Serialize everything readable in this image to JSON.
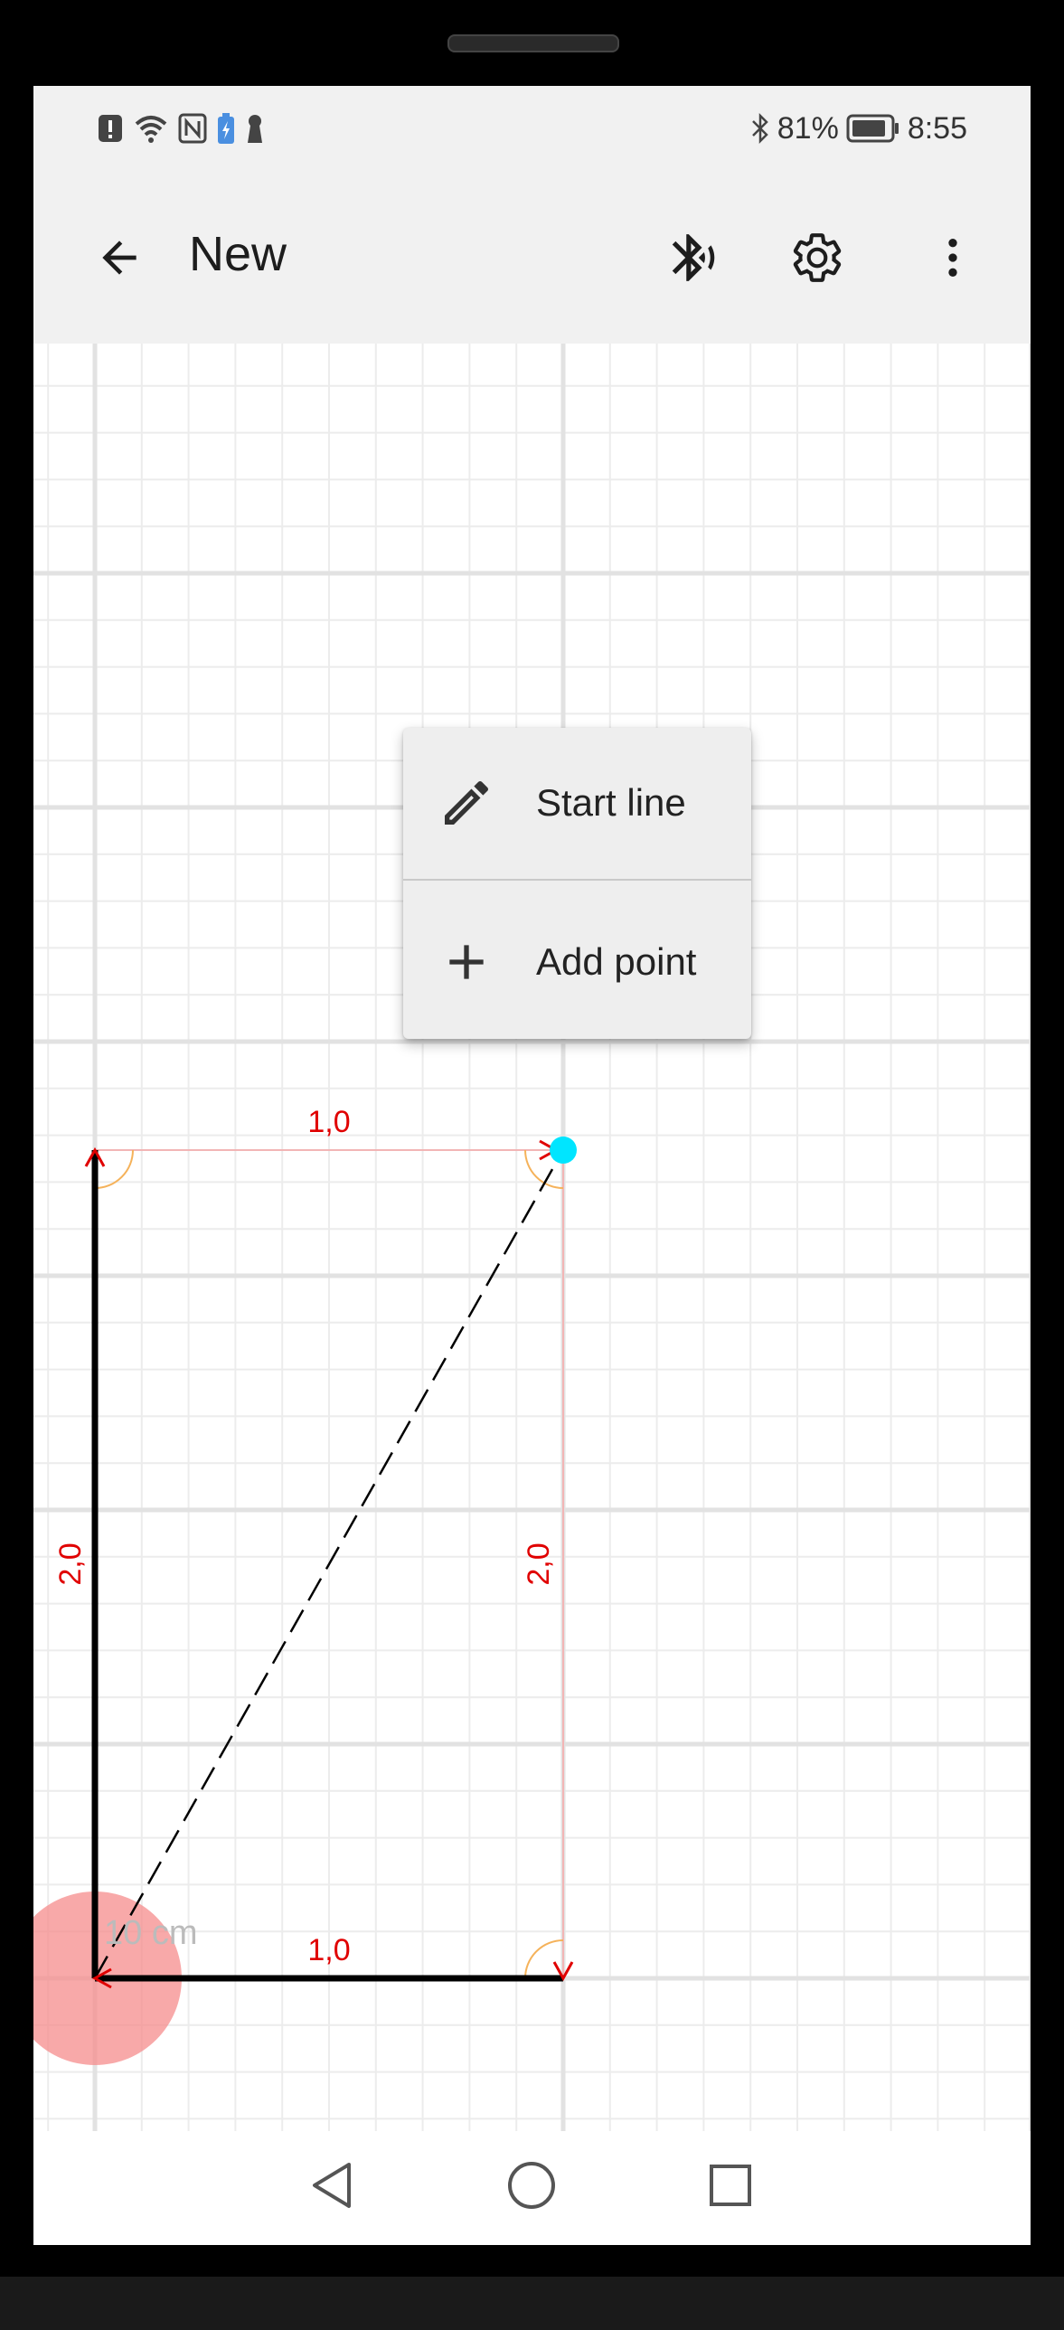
{
  "status_bar": {
    "battery_percent": "81%",
    "time": "8:55",
    "left_icons": [
      "alert-icon",
      "wifi-icon",
      "nfc-icon",
      "battery-saver-icon",
      "keyhole-icon"
    ],
    "right_icons": [
      "bluetooth-icon",
      "battery-icon"
    ]
  },
  "app_bar": {
    "title": "New",
    "back_icon": "arrow-back-icon",
    "action_icons": [
      "bluetooth-audio-icon",
      "gear-icon",
      "more-vert-icon"
    ]
  },
  "context_menu": {
    "items": [
      {
        "label": "Start line",
        "icon": "pencil-icon"
      },
      {
        "label": "Add point",
        "icon": "plus-icon"
      }
    ]
  },
  "drawing": {
    "top_segment_label": "1,0",
    "bottom_segment_label": "1,0",
    "left_segment_label": "2,0",
    "right_segment_label": "2,0",
    "scale_label": "10 cm",
    "line_color": "#000000",
    "guide_color": "#f2b5b5",
    "label_color": "#e00000",
    "point_color": "#00e5ff",
    "origin_color": "#f58c8c"
  },
  "nav_bar": {
    "icons": [
      "back-triangle-icon",
      "home-circle-icon",
      "recents-square-icon"
    ]
  }
}
